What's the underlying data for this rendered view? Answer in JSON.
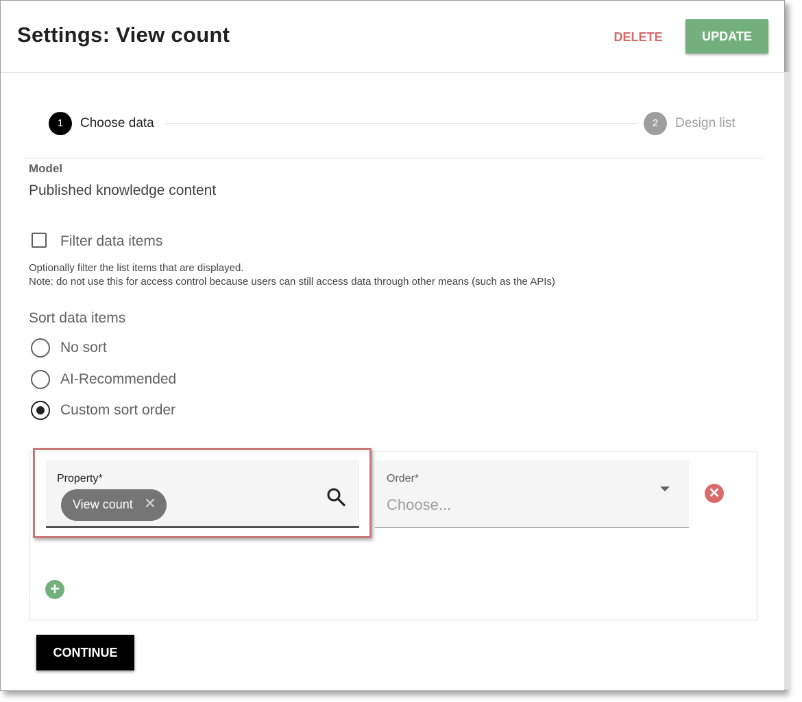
{
  "header": {
    "title": "Settings: View count",
    "delete_label": "DELETE",
    "update_label": "UPDATE"
  },
  "stepper": {
    "steps": [
      {
        "number": "1",
        "label": "Choose data",
        "state": "active"
      },
      {
        "number": "2",
        "label": "Design list",
        "state": "inactive"
      }
    ]
  },
  "model": {
    "label": "Model",
    "value": "Published knowledge content"
  },
  "filter": {
    "label": "Filter data items",
    "checked": false,
    "help_line1": "Optionally filter the list items that are displayed.",
    "help_line2": "Note: do not use this for access control because users can still access data through other means (such as the APIs)"
  },
  "sort": {
    "heading": "Sort data items",
    "options": [
      {
        "label": "No sort",
        "selected": false
      },
      {
        "label": "AI-Recommended",
        "selected": false
      },
      {
        "label": "Custom sort order",
        "selected": true
      }
    ],
    "row": {
      "property_label": "Property*",
      "property_chip": "View count",
      "chip_remove_glyph": "✕",
      "order_label": "Order*",
      "order_placeholder": "Choose...",
      "remove_glyph": "✕",
      "add_glyph": "+"
    }
  },
  "footer": {
    "continue_label": "CONTINUE"
  },
  "icons": {
    "search": "search-icon",
    "dropdown": "chevron-down-icon",
    "remove": "remove-circle-icon",
    "add": "add-circle-icon"
  },
  "colors": {
    "update_button": "#74b07d",
    "delete_text": "#d46a6a",
    "highlight_border": "#c87878",
    "remove_icon": "#d96b6b",
    "add_icon": "#74b07d",
    "chip": "#757575",
    "continue_button": "#000000"
  }
}
